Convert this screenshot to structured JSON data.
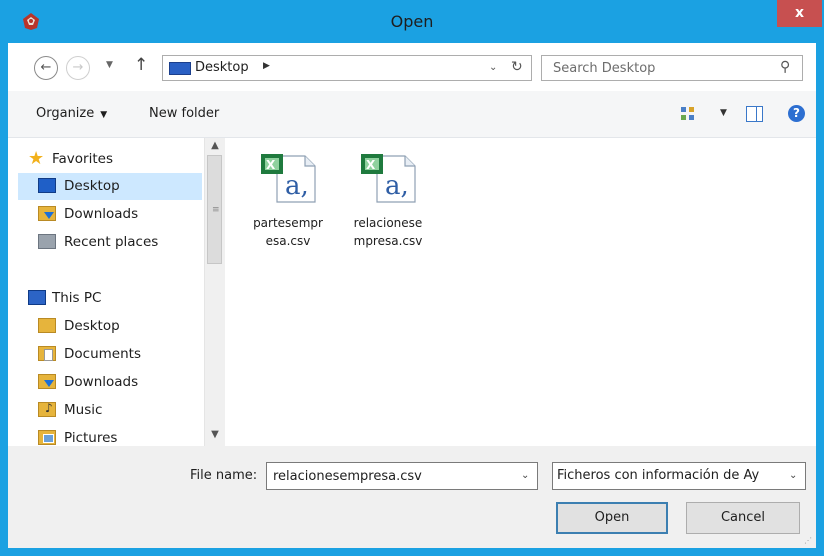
{
  "window": {
    "title": "Open",
    "close_label": "x"
  },
  "address": {
    "location": "Desktop",
    "search_placeholder": "Search Desktop"
  },
  "toolbar": {
    "organize_label": "Organize",
    "new_folder_label": "New folder"
  },
  "nav": {
    "favorites": [
      {
        "label": "Favorites",
        "icon": "star-icon"
      },
      {
        "label": "Desktop",
        "icon": "desktop-icon",
        "selected": true
      },
      {
        "label": "Downloads",
        "icon": "downloads-icon"
      },
      {
        "label": "Recent places",
        "icon": "recent-places-icon"
      }
    ],
    "this_pc": [
      {
        "label": "This PC",
        "icon": "computer-icon"
      },
      {
        "label": "Desktop",
        "icon": "desktop-icon"
      },
      {
        "label": "Documents",
        "icon": "documents-icon"
      },
      {
        "label": "Downloads",
        "icon": "downloads-icon"
      },
      {
        "label": "Music",
        "icon": "music-icon"
      },
      {
        "label": "Pictures",
        "icon": "pictures-icon"
      }
    ]
  },
  "files": [
    {
      "name_line1": "partesempr",
      "name_line2": "esa.csv",
      "icon": "csv-file-icon"
    },
    {
      "name_line1": "relacionese",
      "name_line2": "mpresa.csv",
      "icon": "csv-file-icon"
    }
  ],
  "footer": {
    "file_name_label": "File name:",
    "file_name_value": "relacionesempresa.csv",
    "file_type_value": "Ficheros con información de Ay",
    "open_label": "Open",
    "cancel_label": "Cancel"
  },
  "colors": {
    "window_frame": "#1ba1e2",
    "close_button": "#c75050",
    "selection": "#cde8ff",
    "default_button_border": "#3c7fb1"
  }
}
